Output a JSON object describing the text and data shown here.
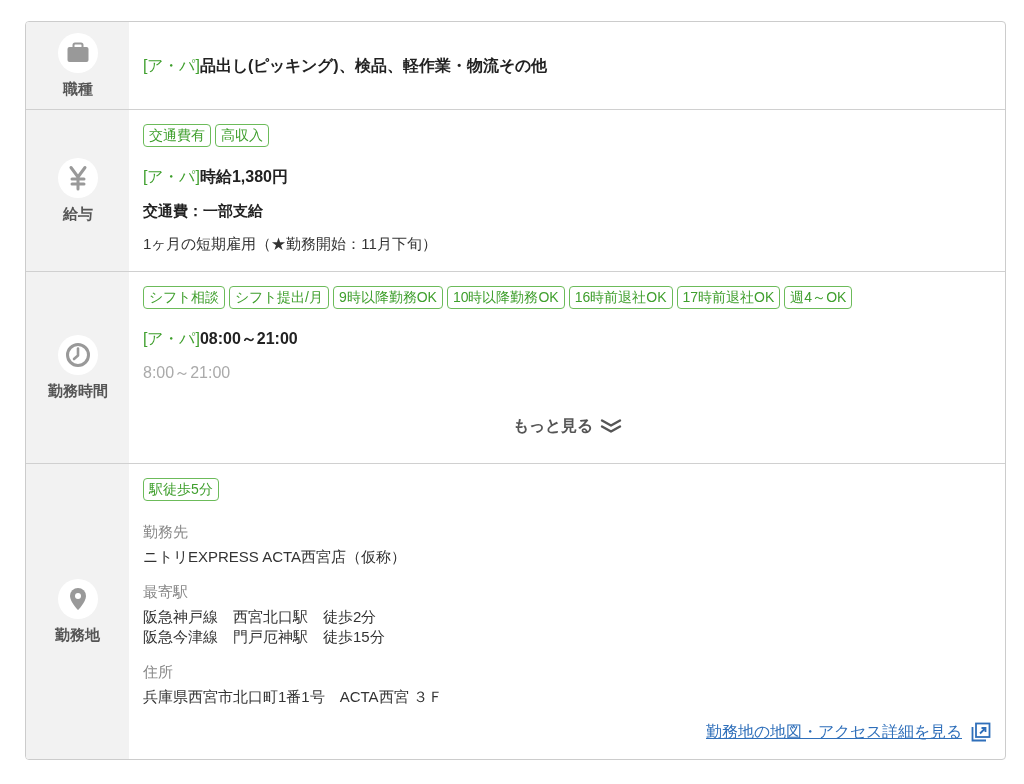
{
  "sections": [
    {
      "kind": "job",
      "label": "職種",
      "lines": [
        {
          "kind": "lead",
          "prefix": "[ア・パ]",
          "text": "品出し(ピッキング)、検品、軽作業・物流その他"
        }
      ]
    },
    {
      "kind": "salary",
      "label": "給与",
      "tags": [
        "交通費有",
        "高収入"
      ],
      "lines": [
        {
          "kind": "lead",
          "prefix": "[ア・パ]",
          "text": "時給1,380円"
        },
        {
          "kind": "bold",
          "text": "交通費：一部支給"
        },
        {
          "kind": "plain",
          "text": "1ヶ月の短期雇用（★勤務開始：11月下旬）"
        }
      ]
    },
    {
      "kind": "hours",
      "label": "勤務時間",
      "tags": [
        "シフト相談",
        "シフト提出/月",
        "9時以降勤務OK",
        "10時以降勤務OK",
        "16時前退社OK",
        "17時前退社OK",
        "週4～OK"
      ],
      "lines": [
        {
          "kind": "lead",
          "prefix": "[ア・パ]",
          "text": "08:00～21:00"
        },
        {
          "kind": "faded",
          "text": "8:00～21:00"
        }
      ],
      "more_button": "もっと見る"
    },
    {
      "kind": "location",
      "label": "勤務地",
      "tags": [
        "駅徒歩5分"
      ],
      "fields": [
        {
          "label": "勤務先",
          "values": [
            "ニトリEXPRESS ACTA西宮店（仮称）"
          ]
        },
        {
          "label": "最寄駅",
          "values": [
            "阪急神戸線　西宮北口駅　徒歩2分",
            "阪急今津線　門戸厄神駅　徒歩15分"
          ]
        },
        {
          "label": "住所",
          "values": [
            "兵庫県西宮市北口町1番1号　ACTA西宮 ３Ｆ"
          ]
        }
      ],
      "link": "勤務地の地図・アクセス詳細を見る"
    }
  ]
}
